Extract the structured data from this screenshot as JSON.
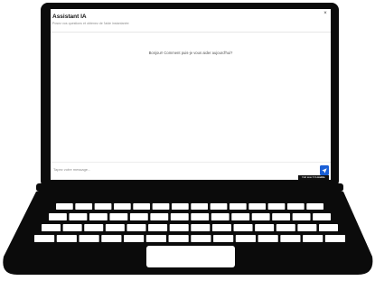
{
  "app": {
    "title": "Assistant IA",
    "subtitle": "Posez vos questions et obtenez de l'aide instantanée",
    "close_glyph": "×"
  },
  "chat": {
    "welcome_message": "Bonjour! Comment puis-je vous aider aujourd'hui?"
  },
  "composer": {
    "placeholder": "Tapez votre message...",
    "send_icon": "send-icon"
  },
  "branding": {
    "prefix": "Fait avec",
    "name": "Loveble"
  },
  "colors": {
    "accent": "#1a5fd6",
    "device_frame": "#0b0b0b",
    "keys": "#ffffff",
    "badge_background": "#111111"
  }
}
